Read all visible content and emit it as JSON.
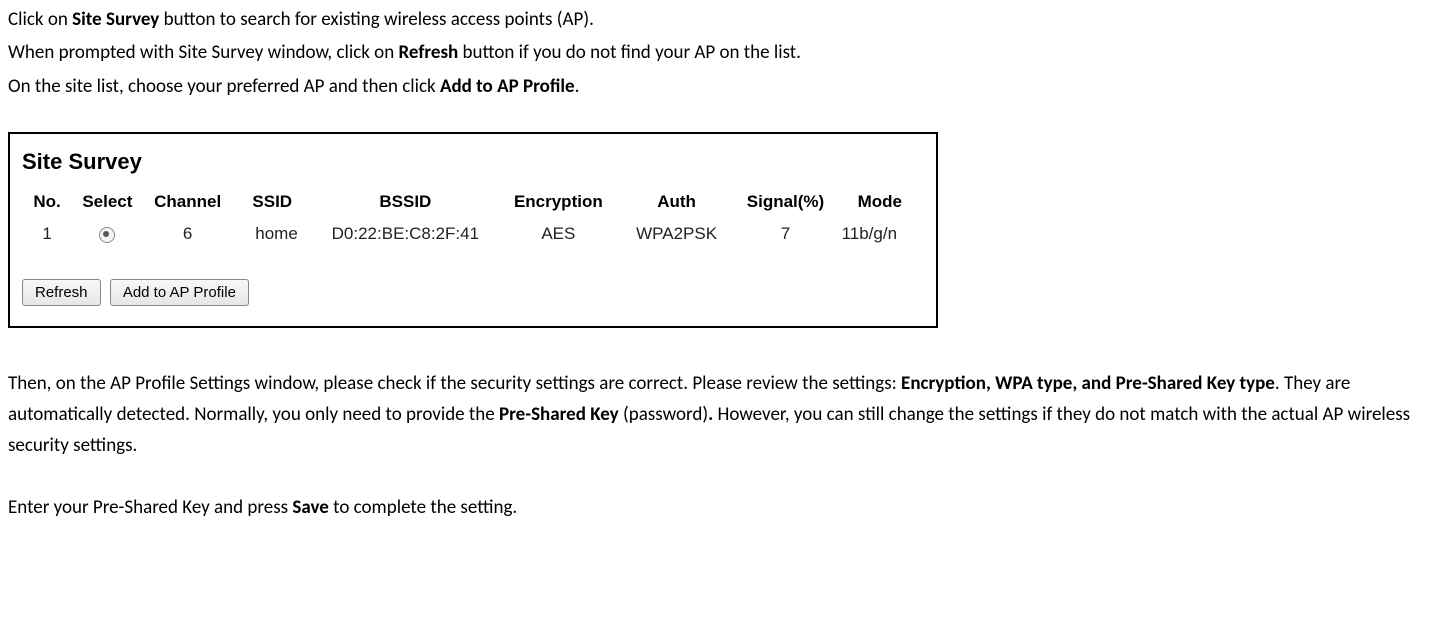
{
  "intro": {
    "line1_pre": "Click on ",
    "line1_bold": "Site Survey",
    "line1_post": " button to search for existing wireless access points (AP).",
    "line2_pre": "When prompted with Site Survey window, click on ",
    "line2_bold": "Refresh",
    "line2_post": " button if you do not find your AP on the list.",
    "line3_pre": "On the site list, choose your preferred AP and then click ",
    "line3_bold": "Add to AP Profile",
    "line3_post": "."
  },
  "survey": {
    "title": "Site Survey",
    "headers": {
      "no": "No.",
      "select": "Select",
      "channel": "Channel",
      "ssid": "SSID",
      "bssid": "BSSID",
      "encryption": "Encryption",
      "auth": "Auth",
      "signal": "Signal(%)",
      "mode": "Mode"
    },
    "row": {
      "no": "1",
      "channel": "6",
      "ssid": "home",
      "bssid": "D0:22:BE:C8:2F:41",
      "encryption": "AES",
      "auth": "WPA2PSK",
      "signal": "7",
      "mode": "11b/g/n"
    },
    "buttons": {
      "refresh": "Refresh",
      "add": "Add to AP Profile"
    }
  },
  "outro": {
    "p1_a": "Then, on the AP Profile Settings window, please check if the security settings are correct. Please review the settings: ",
    "p1_b_bold": "Encryption, WPA type, and Pre-Shared Key type",
    "p1_c": ". They are automatically detected. Normally, you only need to provide the ",
    "p1_d_bold": "Pre-Shared Key",
    "p1_e": " (password)",
    "p1_f_bold": ".",
    "p1_g": " However, you can still change the settings if they do not match with the actual AP wireless security settings.",
    "p2_a": "Enter your Pre-Shared Key and press ",
    "p2_b_bold": "Save",
    "p2_c": " to complete the setting."
  }
}
